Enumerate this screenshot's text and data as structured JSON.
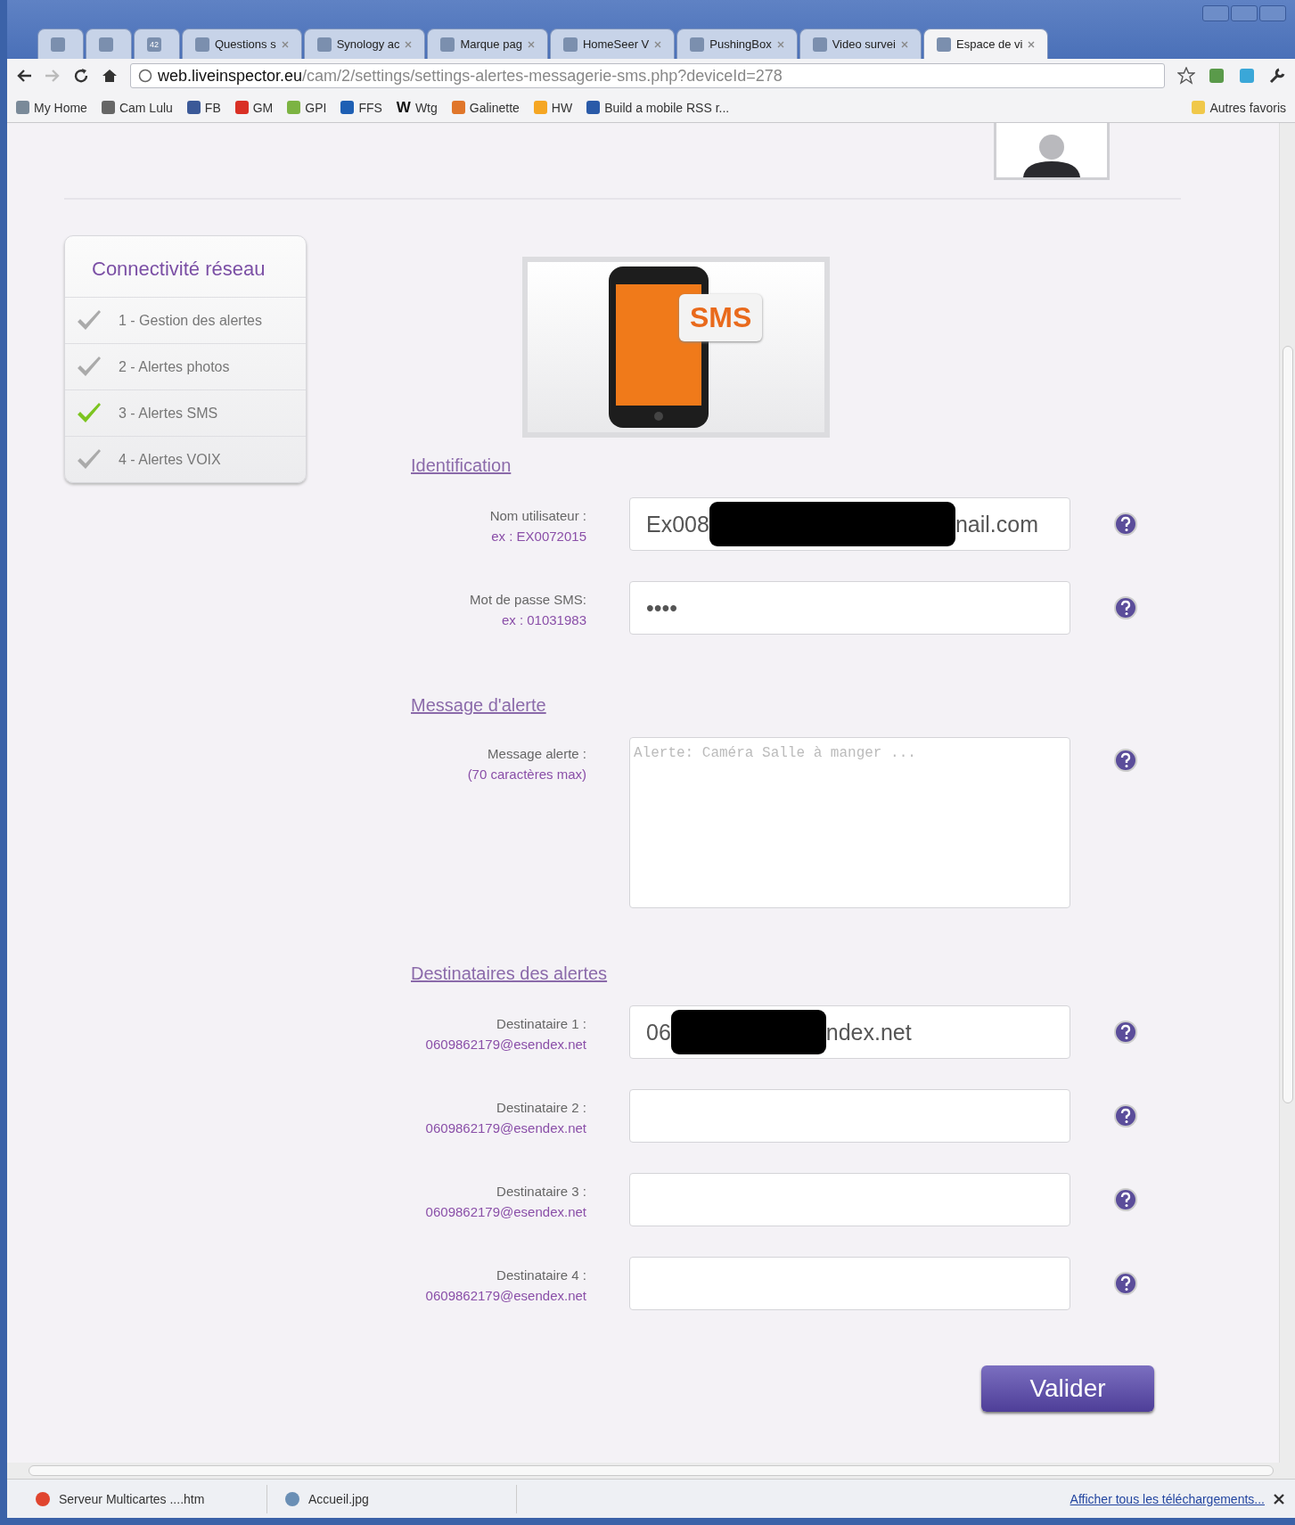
{
  "browser": {
    "tabs": [
      {
        "selected": false
      },
      {
        "selected": false
      },
      {
        "label": "42",
        "selected": false
      },
      {
        "label": "Questions s",
        "selected": false
      },
      {
        "label": "Synology ac",
        "selected": false
      },
      {
        "label": "Marque pag",
        "selected": false
      },
      {
        "label": "HomeSeer V",
        "selected": false
      },
      {
        "label": "PushingBox",
        "selected": false
      },
      {
        "label": "Video survei",
        "selected": false
      },
      {
        "label": "Espace de vi",
        "selected": true
      }
    ],
    "url_host": "web.liveinspector.eu",
    "url_path": "/cam/2/settings/settings-alertes-messagerie-sms.php?deviceId=278",
    "bookmarks": [
      {
        "label": "My Home",
        "color": "#7a8a99"
      },
      {
        "label": "Cam Lulu",
        "color": "#666666"
      },
      {
        "label": "FB",
        "color": "#3b5998"
      },
      {
        "label": "GM",
        "color": "#d93025"
      },
      {
        "label": "GPI",
        "color": "#7cb342"
      },
      {
        "label": "FFS",
        "color": "#1e5fb4"
      },
      {
        "label": "Wtg",
        "color": "#111111",
        "glyph": "W"
      },
      {
        "label": "Galinette",
        "color": "#e0762b"
      },
      {
        "label": "HW",
        "color": "#f5a623"
      },
      {
        "label": "Build a mobile RSS r...",
        "color": "#2a5aa8"
      }
    ],
    "other_bookmarks": "Autres favoris"
  },
  "sidebar": {
    "title": "Connectivité réseau",
    "steps": [
      {
        "label": "1 - Gestion des alertes",
        "selected": false
      },
      {
        "label": "2 - Alertes photos",
        "selected": false
      },
      {
        "label": "3 - Alertes SMS",
        "selected": true
      },
      {
        "label": "4 - Alertes VOIX",
        "selected": false
      }
    ]
  },
  "hero_image": {
    "bubble_text": "SMS"
  },
  "sections": [
    {
      "heading": "Identification",
      "fields": [
        {
          "kind": "text",
          "label": "Nom utilisateur :",
          "hint": "ex : EX0072015",
          "value_start": "Ex008",
          "value_end": "nail.com",
          "redacted": true
        },
        {
          "kind": "password",
          "label": "Mot de passe SMS:",
          "hint": "ex : 01031983",
          "value_start": "••••"
        }
      ]
    },
    {
      "heading": "Message d'alerte",
      "fields": [
        {
          "kind": "textarea",
          "label": "Message alerte :",
          "hint": "(70 caractères max)",
          "placeholder": "Alerte: Caméra Salle à manger ..."
        }
      ]
    },
    {
      "heading": "Destinataires des alertes",
      "fields": [
        {
          "kind": "text",
          "label": "Destinataire 1 :",
          "hint": "0609862179@esendex.net",
          "value_start": "06",
          "value_end": "ndex.net",
          "redacted": true
        },
        {
          "kind": "text",
          "label": "Destinataire 2 :",
          "hint": "0609862179@esendex.net"
        },
        {
          "kind": "text",
          "label": "Destinataire 3 :",
          "hint": "0609862179@esendex.net"
        },
        {
          "kind": "text",
          "label": "Destinataire 4 :",
          "hint": "0609862179@esendex.net"
        }
      ]
    }
  ],
  "submit": "Valider",
  "downloads": {
    "items": [
      "Serveur Multicartes ....htm",
      "Accueil.jpg"
    ],
    "show_all": "Afficher tous les téléchargements..."
  }
}
